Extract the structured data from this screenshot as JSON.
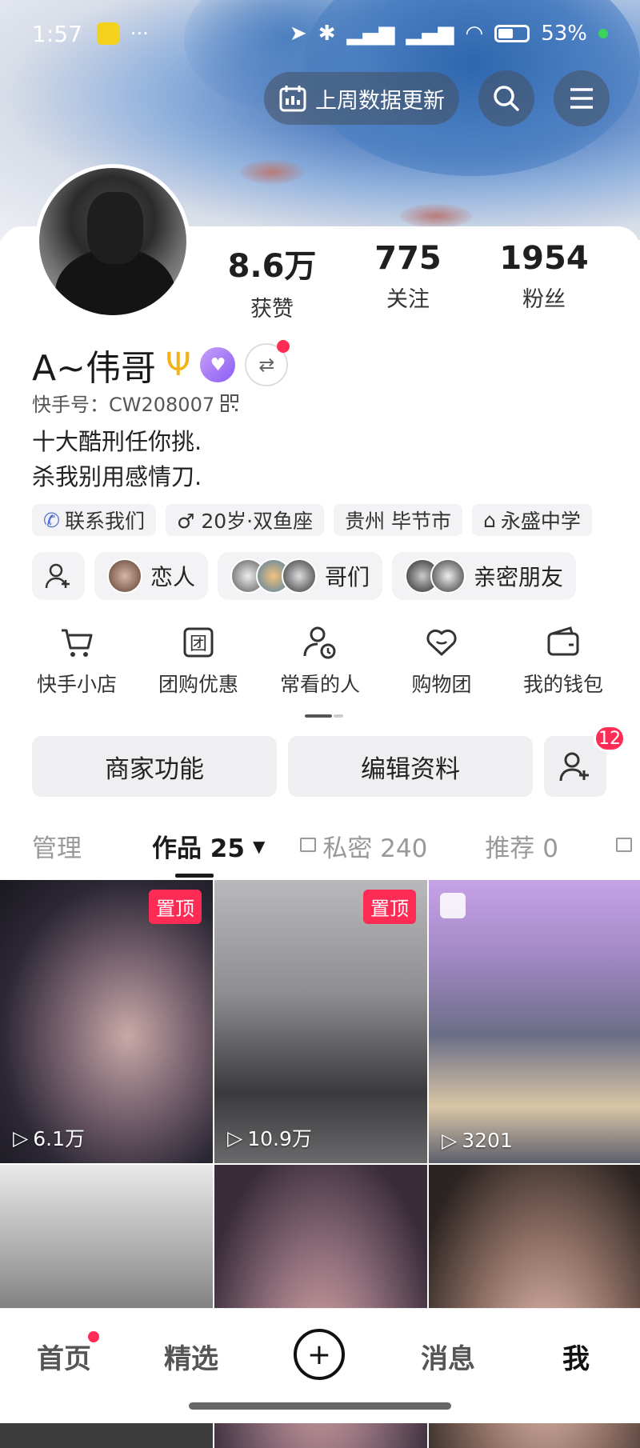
{
  "status_bar": {
    "time": "1:57",
    "dots": "···",
    "battery": "53%"
  },
  "header": {
    "weekly_update_label": "上周数据更新"
  },
  "profile": {
    "stats": [
      {
        "value": "8.6万",
        "label": "获赞"
      },
      {
        "value": "775",
        "label": "关注"
      },
      {
        "value": "1954",
        "label": "粉丝"
      }
    ],
    "name": "A~伟哥",
    "kuaishou_id": "快手号：CW208007",
    "bio_line1": "十大酷刑任你挑.",
    "bio_line2": "杀我别用感情刀."
  },
  "chips": [
    {
      "label": "联系我们",
      "icon": "phone-icon"
    },
    {
      "label": "♂ 20岁·双鱼座",
      "icon": "male-icon"
    },
    {
      "label": "贵州 毕节市",
      "icon": ""
    },
    {
      "label": "永盛中学",
      "icon": "school-icon"
    }
  ],
  "relations": [
    {
      "label": "恋人"
    },
    {
      "label": "哥们"
    },
    {
      "label": "亲密朋友"
    }
  ],
  "tools": [
    {
      "label": "快手小店",
      "icon": "cart-icon"
    },
    {
      "label": "团购优惠",
      "icon": "group-buy-icon"
    },
    {
      "label": "常看的人",
      "icon": "frequent-people-icon"
    },
    {
      "label": "购物团",
      "icon": "heart-bag-icon"
    },
    {
      "label": "我的钱包",
      "icon": "wallet-icon"
    }
  ],
  "actions": {
    "merchant": "商家功能",
    "edit_profile": "编辑资料",
    "friend_requests": "12"
  },
  "tabs": {
    "manage": "管理",
    "works": "作品 25",
    "private": "私密 240",
    "recommend": "推荐 0"
  },
  "videos": [
    {
      "pinned": "置顶",
      "views": "6.1万"
    },
    {
      "pinned": "置顶",
      "views": "10.9万"
    },
    {
      "pinned": "",
      "views": "3201"
    },
    {
      "pinned": "",
      "views": ""
    },
    {
      "pinned": "",
      "views": ""
    },
    {
      "pinned": "",
      "views": ""
    }
  ],
  "bottom_nav": {
    "home": "首页",
    "featured": "精选",
    "plus": "+",
    "messages": "消息",
    "me": "我"
  }
}
